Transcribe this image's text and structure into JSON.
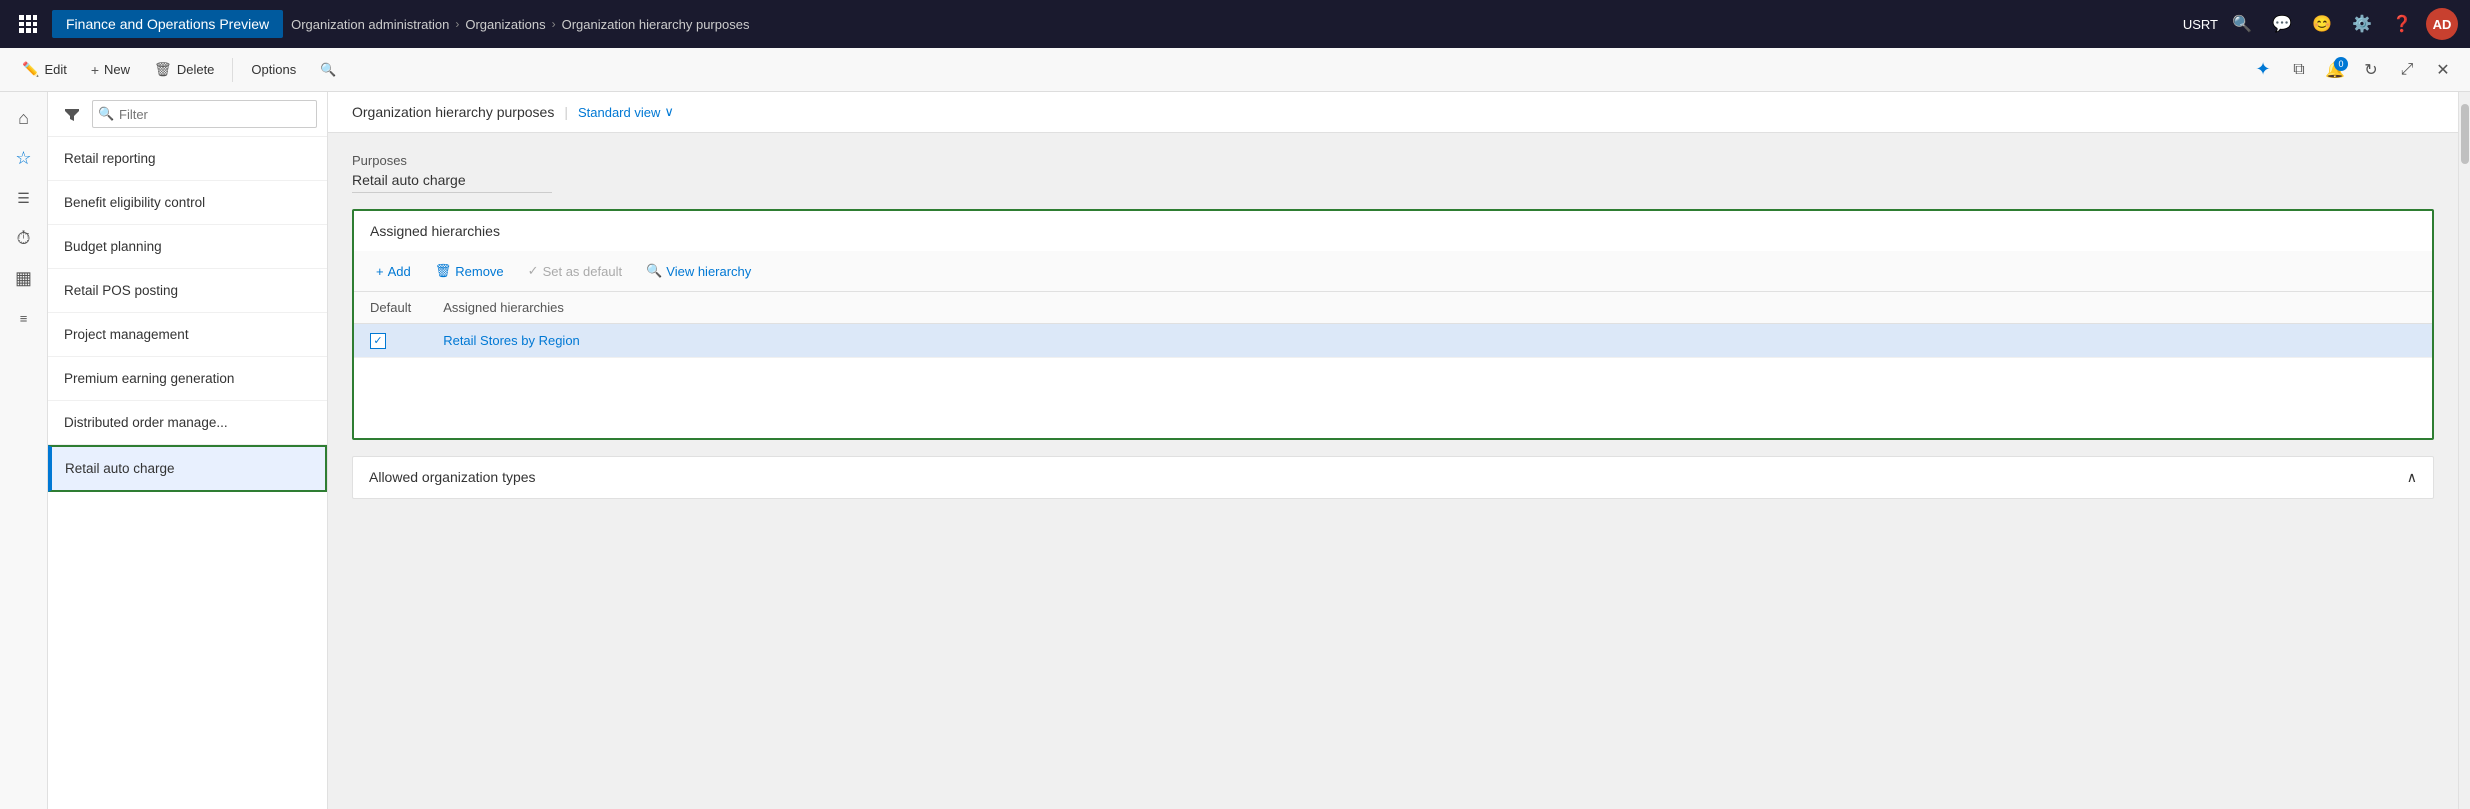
{
  "topbar": {
    "app_title": "Finance and Operations Preview",
    "breadcrumb": [
      {
        "label": "Organization administration"
      },
      {
        "label": "Organizations"
      },
      {
        "label": "Organization hierarchy purposes"
      }
    ],
    "username": "USRT",
    "avatar_initials": "AD"
  },
  "actionbar": {
    "edit_label": "Edit",
    "new_label": "New",
    "delete_label": "Delete",
    "options_label": "Options"
  },
  "detail": {
    "page_title": "Organization hierarchy purposes",
    "view_label": "Standard view",
    "purposes_label": "Purposes",
    "purposes_value": "Retail auto charge",
    "assigned_hierarchies_label": "Assigned hierarchies",
    "add_label": "Add",
    "remove_label": "Remove",
    "set_as_default_label": "Set as default",
    "view_hierarchy_label": "View hierarchy",
    "col_default": "Default",
    "col_assigned": "Assigned hierarchies",
    "hierarchy_row": "Retail Stores by Region",
    "allowed_org_types_label": "Allowed organization types"
  },
  "list": {
    "filter_placeholder": "Filter",
    "items": [
      {
        "label": "Retail reporting",
        "active": false
      },
      {
        "label": "Benefit eligibility control",
        "active": false
      },
      {
        "label": "Budget planning",
        "active": false
      },
      {
        "label": "Retail POS posting",
        "active": false
      },
      {
        "label": "Project management",
        "active": false
      },
      {
        "label": "Premium earning generation",
        "active": false
      },
      {
        "label": "Distributed order manage...",
        "active": false
      },
      {
        "label": "Retail auto charge",
        "active": true
      }
    ]
  }
}
